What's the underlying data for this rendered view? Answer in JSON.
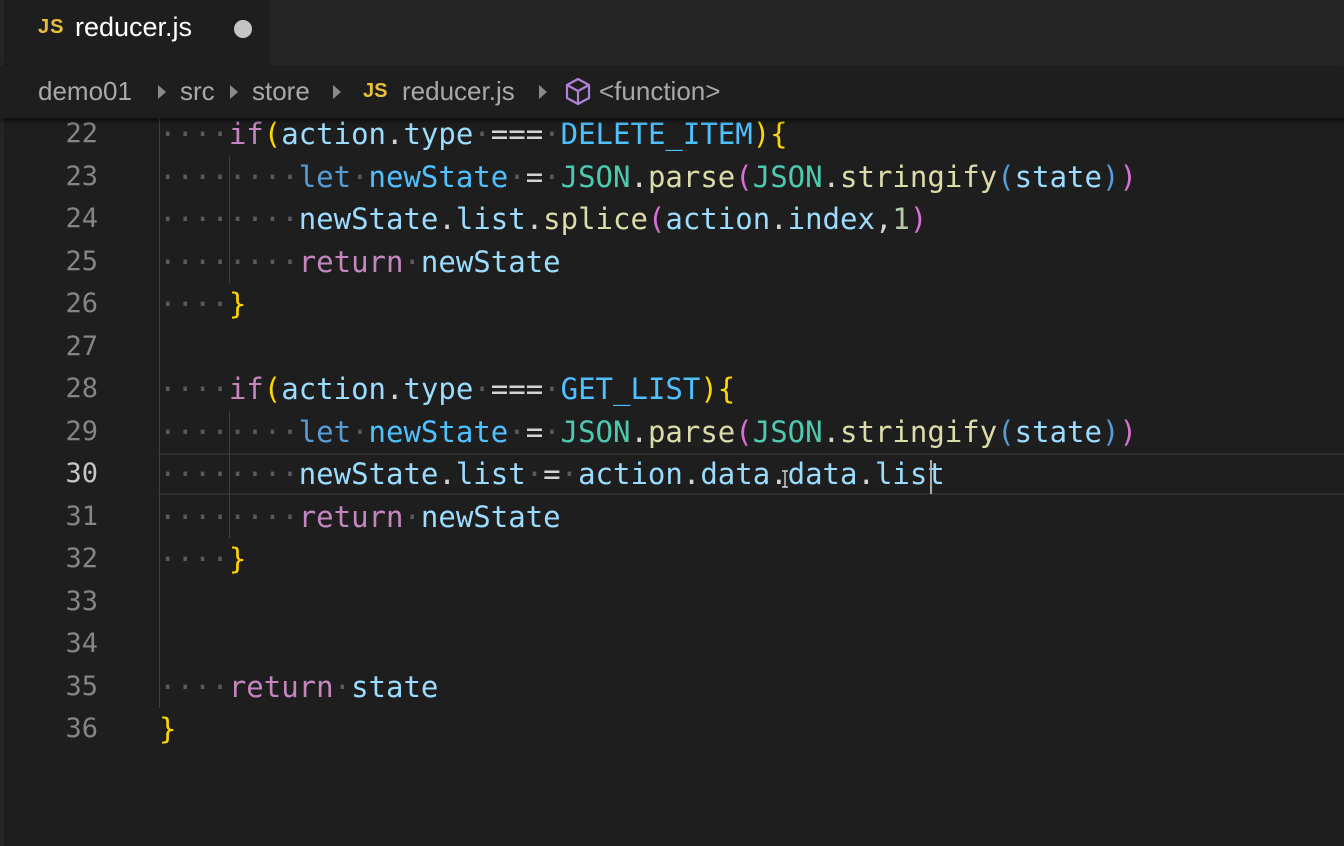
{
  "tab": {
    "icon": "JS",
    "title": "reducer.js",
    "dirty_icon": "unsaved-dot-icon"
  },
  "breadcrumb": {
    "items": [
      "demo01",
      "src",
      "store"
    ],
    "file_icon": "JS",
    "file": "reducer.js",
    "symbol": "<function>"
  },
  "colors": {
    "keyword": "#c586c0",
    "storage": "#569cd6",
    "variable": "#9cdcfe",
    "constant": "#4fc1ff",
    "function": "#dcdcaa",
    "class": "#4ec9b0",
    "number": "#b5cea8",
    "js_badge": "#e8c13c"
  },
  "editor": {
    "active_line": 30,
    "lines": [
      {
        "n": "22",
        "tokens": [
          [
            "ws",
            "····"
          ],
          [
            "kw",
            "if"
          ],
          [
            "br",
            "("
          ],
          [
            "vr",
            "action"
          ],
          [
            "p",
            "."
          ],
          [
            "vr",
            "type"
          ],
          [
            "ws",
            "·"
          ],
          [
            "p",
            "==="
          ],
          [
            "ws",
            "·"
          ],
          [
            "cn",
            "DELETE_ITEM"
          ],
          [
            "br",
            ")"
          ],
          [
            "br",
            "{"
          ]
        ]
      },
      {
        "n": "23",
        "tokens": [
          [
            "ws",
            "········"
          ],
          [
            "st",
            "let"
          ],
          [
            "ws",
            "·"
          ],
          [
            "cn",
            "newState"
          ],
          [
            "ws",
            "·"
          ],
          [
            "p",
            "="
          ],
          [
            "ws",
            "·"
          ],
          [
            "cl",
            "JSON"
          ],
          [
            "p",
            "."
          ],
          [
            "fn",
            "parse"
          ],
          [
            "br2",
            "("
          ],
          [
            "cl",
            "JSON"
          ],
          [
            "p",
            "."
          ],
          [
            "fn",
            "stringify"
          ],
          [
            "st",
            "("
          ],
          [
            "vr",
            "state"
          ],
          [
            "st",
            ")"
          ],
          [
            "br2",
            ")"
          ]
        ]
      },
      {
        "n": "24",
        "tokens": [
          [
            "ws",
            "········"
          ],
          [
            "vr",
            "newState"
          ],
          [
            "p",
            "."
          ],
          [
            "vr",
            "list"
          ],
          [
            "p",
            "."
          ],
          [
            "fn",
            "splice"
          ],
          [
            "br2",
            "("
          ],
          [
            "vr",
            "action"
          ],
          [
            "p",
            "."
          ],
          [
            "vr",
            "index"
          ],
          [
            "p",
            ","
          ],
          [
            "nu",
            "1"
          ],
          [
            "br2",
            ")"
          ]
        ]
      },
      {
        "n": "25",
        "tokens": [
          [
            "ws",
            "········"
          ],
          [
            "kw",
            "return"
          ],
          [
            "ws",
            "·"
          ],
          [
            "vr",
            "newState"
          ]
        ]
      },
      {
        "n": "26",
        "tokens": [
          [
            "ws",
            "····"
          ],
          [
            "br",
            "}"
          ]
        ]
      },
      {
        "n": "27",
        "tokens": []
      },
      {
        "n": "28",
        "tokens": [
          [
            "ws",
            "····"
          ],
          [
            "kw",
            "if"
          ],
          [
            "br",
            "("
          ],
          [
            "vr",
            "action"
          ],
          [
            "p",
            "."
          ],
          [
            "vr",
            "type"
          ],
          [
            "ws",
            "·"
          ],
          [
            "p",
            "==="
          ],
          [
            "ws",
            "·"
          ],
          [
            "cn",
            "GET_LIST"
          ],
          [
            "br",
            ")"
          ],
          [
            "br",
            "{"
          ]
        ]
      },
      {
        "n": "29",
        "tokens": [
          [
            "ws",
            "········"
          ],
          [
            "st",
            "let"
          ],
          [
            "ws",
            "·"
          ],
          [
            "cn",
            "newState"
          ],
          [
            "ws",
            "·"
          ],
          [
            "p",
            "="
          ],
          [
            "ws",
            "·"
          ],
          [
            "cl",
            "JSON"
          ],
          [
            "p",
            "."
          ],
          [
            "fn",
            "parse"
          ],
          [
            "br2",
            "("
          ],
          [
            "cl",
            "JSON"
          ],
          [
            "p",
            "."
          ],
          [
            "fn",
            "stringify"
          ],
          [
            "st",
            "("
          ],
          [
            "vr",
            "state"
          ],
          [
            "st",
            ")"
          ],
          [
            "br2",
            ")"
          ]
        ]
      },
      {
        "n": "30",
        "tokens": [
          [
            "ws",
            "········"
          ],
          [
            "vr",
            "newState"
          ],
          [
            "p",
            "."
          ],
          [
            "vr",
            "list"
          ],
          [
            "ws",
            "·"
          ],
          [
            "p",
            "="
          ],
          [
            "ws",
            "·"
          ],
          [
            "vr",
            "action"
          ],
          [
            "p",
            "."
          ],
          [
            "vr",
            "data"
          ],
          [
            "p",
            "."
          ],
          [
            "vr",
            "data"
          ],
          [
            "p",
            "."
          ],
          [
            "vr",
            "list"
          ]
        ]
      },
      {
        "n": "31",
        "tokens": [
          [
            "ws",
            "········"
          ],
          [
            "kw",
            "return"
          ],
          [
            "ws",
            "·"
          ],
          [
            "vr",
            "newState"
          ]
        ]
      },
      {
        "n": "32",
        "tokens": [
          [
            "ws",
            "····"
          ],
          [
            "br",
            "}"
          ]
        ]
      },
      {
        "n": "33",
        "tokens": []
      },
      {
        "n": "34",
        "tokens": []
      },
      {
        "n": "35",
        "tokens": [
          [
            "ws",
            "····"
          ],
          [
            "kw",
            "return"
          ],
          [
            "ws",
            "·"
          ],
          [
            "vr",
            "state"
          ]
        ]
      },
      {
        "n": "36",
        "tokens": [
          [
            "br",
            "}"
          ]
        ]
      }
    ]
  }
}
